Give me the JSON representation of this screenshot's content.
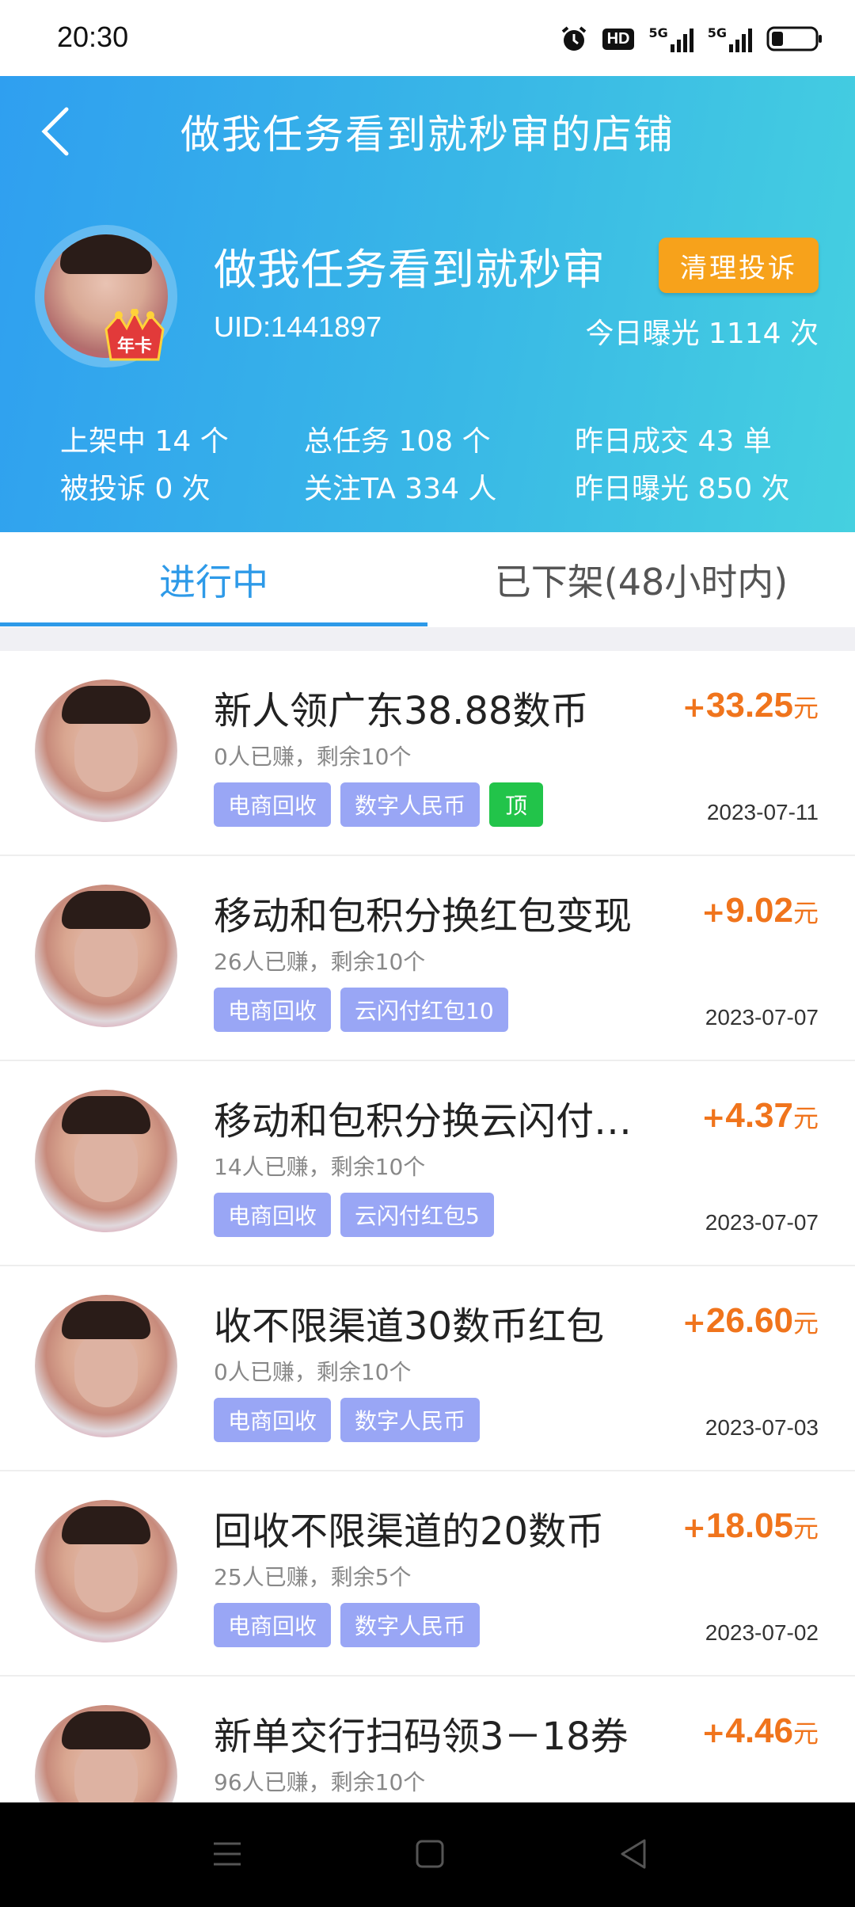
{
  "status_bar": {
    "time": "20:30",
    "icons": [
      "alarm-icon",
      "hd-icon",
      "signal-5g-icon",
      "signal-5g-icon",
      "battery-icon"
    ],
    "hd_label": "HD",
    "net_label": "5G"
  },
  "header": {
    "title": "做我任务看到就秒审的店铺",
    "shop_name": "做我任务看到就秒审",
    "uid": "UID:1441897",
    "badge_text": "年卡",
    "clear_button": "清理投诉",
    "today_exposure": "今日曝光 1114 次",
    "stats": {
      "listed": "上架中 14 个",
      "total_tasks": "总任务 108 个",
      "yesterday_deals": "昨日成交 43 单",
      "complaints": "被投诉 0 次",
      "followers": "关注TA 334 人",
      "yesterday_exposure": "昨日曝光 850 次"
    },
    "colors": {
      "gradient_start": "#2f9ff0",
      "gradient_end": "#45d0e0",
      "button": "#f7a21b"
    }
  },
  "tabs": {
    "active": "进行中",
    "inactive": "已下架(48小时内)"
  },
  "tasks": [
    {
      "title": "新人领广东38.88数币",
      "meta": "0人已赚，剩余10个",
      "tags": [
        "电商回收",
        "数字人民币"
      ],
      "top_tag": "顶",
      "reward_plus": "+",
      "reward": "33.25",
      "unit": "元",
      "date": "2023-07-11"
    },
    {
      "title": "移动和包积分换红包变现",
      "meta": "26人已赚，剩余10个",
      "tags": [
        "电商回收",
        "云闪付红包10"
      ],
      "reward_plus": "+",
      "reward": "9.02",
      "unit": "元",
      "date": "2023-07-07"
    },
    {
      "title": "移动和包积分换云闪付…",
      "meta": "14人已赚，剩余10个",
      "tags": [
        "电商回收",
        "云闪付红包5"
      ],
      "reward_plus": "+",
      "reward": "4.37",
      "unit": "元",
      "date": "2023-07-07"
    },
    {
      "title": "收不限渠道30数币红包",
      "meta": "0人已赚，剩余10个",
      "tags": [
        "电商回收",
        "数字人民币"
      ],
      "reward_plus": "+",
      "reward": "26.60",
      "unit": "元",
      "date": "2023-07-03"
    },
    {
      "title": "回收不限渠道的20数币",
      "meta": "25人已赚，剩余5个",
      "tags": [
        "电商回收",
        "数字人民币"
      ],
      "reward_plus": "+",
      "reward": "18.05",
      "unit": "元",
      "date": "2023-07-02"
    },
    {
      "title": "新单交行扫码领3－18券",
      "meta": "96人已赚，剩余10个",
      "tags": [],
      "reward_plus": "+",
      "reward": "4.46",
      "unit": "元",
      "date": ""
    }
  ],
  "nav_bar": {
    "icons": [
      "menu-icon",
      "home-square-icon",
      "back-triangle-icon"
    ]
  }
}
